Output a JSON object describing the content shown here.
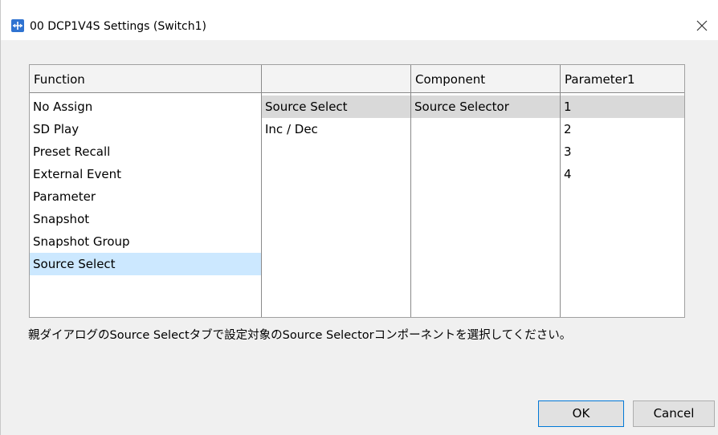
{
  "window": {
    "title": "00 DCP1V4S Settings (Switch1)",
    "close_glyph": "✕",
    "icon": "app-icon"
  },
  "table": {
    "columns": [
      {
        "header": "Function"
      },
      {
        "header": ""
      },
      {
        "header": "Component"
      },
      {
        "header": "Parameter1"
      }
    ],
    "function_items": [
      "No Assign",
      "SD Play",
      "Preset Recall",
      "External Event",
      "Parameter",
      "Snapshot",
      "Snapshot Group",
      "Source Select"
    ],
    "function_selected": "Source Select",
    "sub_items": [
      "Source Select",
      "Inc / Dec"
    ],
    "sub_selected": "Source Select",
    "component_items": [
      "Source Selector"
    ],
    "parameter_items": [
      "1",
      "2",
      "3",
      "4"
    ]
  },
  "hint_text": "親ダイアログのSource Selectタブで設定対象のSource Selectorコンポーネントを選択してください。",
  "buttons": {
    "ok": "OK",
    "cancel": "Cancel"
  },
  "colors": {
    "selection_blue": "#cce8ff",
    "selection_gray": "#d9d9d9",
    "focus_border": "#0078d7",
    "app_icon": "#2f73d1"
  }
}
